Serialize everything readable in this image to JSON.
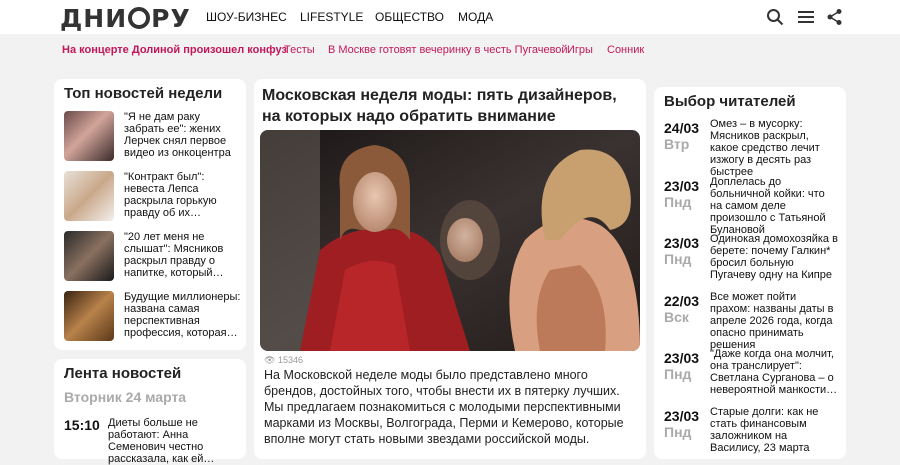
{
  "header": {
    "logo_text_left": "ДНИ",
    "logo_text_right": "РУ",
    "nav": [
      "ШОУ-БИЗНЕС",
      "LIFESTYLE",
      "ОБЩЕСТВО",
      "МОДА"
    ],
    "icons": [
      "search-icon",
      "menu-icon",
      "share-icon"
    ]
  },
  "subnav": [
    "На концерте Долиной произошел конфуз",
    "Тесты",
    "В Москве готовят вечеринку в честь Пугачевой",
    "Игры",
    "Сонник"
  ],
  "top_news": {
    "title": "Топ новостей недели",
    "items": [
      "\"Я не дам раку забрать ее\": жених Лерчек снял первое видео из онкоцентра",
      "\"Контракт был\": невеста Лепса раскрыла горькую правду об их…",
      "\"20 лет меня не слышат\": Мясников раскрыл правду о напитке, который…",
      "Будущие миллионеры: названа самая перспективная профессия, которая…"
    ]
  },
  "feed": {
    "title": "Лента новостей",
    "date": "Вторник 24 марта",
    "time": "15:10",
    "text": "Диеты больше не работают: Анна Семенович честно рассказала, как ей…"
  },
  "main": {
    "title": "Московская неделя моды: пять дизайнеров, на которых надо обратить внимание",
    "views": "15346",
    "lead": "На Московской неделе моды было представлено много брендов, достойных того, чтобы внести их в пятерку лучших. Мы предлагаем познакомиться с молодыми перспективными марками из Москвы, Волгограда, Перми и Кемерово, которые вполне могут стать новыми звездами российской моды."
  },
  "readers": {
    "title": "Выбор читателей",
    "items": [
      {
        "day": "24/03",
        "wd": "Втр",
        "text": "Омез – в мусорку: Мясников раскрыл, какое средство лечит изжогу в десять раз быстрее"
      },
      {
        "day": "23/03",
        "wd": "Пнд",
        "text": "Доплелась до больничной койки: что на самом деле произошло с Татьяной Булановой"
      },
      {
        "day": "23/03",
        "wd": "Пнд",
        "text": "Одинокая домохозяйка в берете: почему Галкин* бросил больную Пугачеву одну на Кипре"
      },
      {
        "day": "22/03",
        "wd": "Вск",
        "text": "Все может пойти прахом: названы даты в апреле 2026 года, когда опасно принимать решения"
      },
      {
        "day": "23/03",
        "wd": "Пнд",
        "text": "\"Даже когда она молчит, она транслирует\": Светлана Сурганова – о невероятной манкости…"
      },
      {
        "day": "23/03",
        "wd": "Пнд",
        "text": "Старые долги: как не стать финансовым заложником на Василису, 23 марта"
      }
    ]
  }
}
